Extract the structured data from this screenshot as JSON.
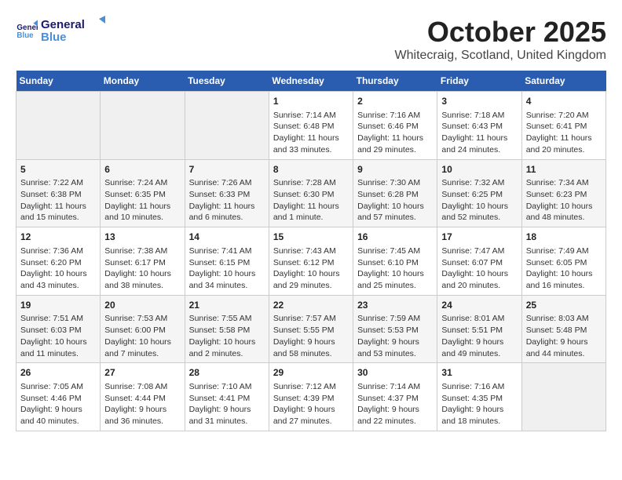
{
  "header": {
    "logo": {
      "line1": "General",
      "line2": "Blue"
    },
    "title": "October 2025",
    "location": "Whitecraig, Scotland, United Kingdom"
  },
  "weekdays": [
    "Sunday",
    "Monday",
    "Tuesday",
    "Wednesday",
    "Thursday",
    "Friday",
    "Saturday"
  ],
  "weeks": [
    [
      {
        "day": "",
        "info": ""
      },
      {
        "day": "",
        "info": ""
      },
      {
        "day": "",
        "info": ""
      },
      {
        "day": "1",
        "info": "Sunrise: 7:14 AM\nSunset: 6:48 PM\nDaylight: 11 hours\nand 33 minutes."
      },
      {
        "day": "2",
        "info": "Sunrise: 7:16 AM\nSunset: 6:46 PM\nDaylight: 11 hours\nand 29 minutes."
      },
      {
        "day": "3",
        "info": "Sunrise: 7:18 AM\nSunset: 6:43 PM\nDaylight: 11 hours\nand 24 minutes."
      },
      {
        "day": "4",
        "info": "Sunrise: 7:20 AM\nSunset: 6:41 PM\nDaylight: 11 hours\nand 20 minutes."
      }
    ],
    [
      {
        "day": "5",
        "info": "Sunrise: 7:22 AM\nSunset: 6:38 PM\nDaylight: 11 hours\nand 15 minutes."
      },
      {
        "day": "6",
        "info": "Sunrise: 7:24 AM\nSunset: 6:35 PM\nDaylight: 11 hours\nand 10 minutes."
      },
      {
        "day": "7",
        "info": "Sunrise: 7:26 AM\nSunset: 6:33 PM\nDaylight: 11 hours\nand 6 minutes."
      },
      {
        "day": "8",
        "info": "Sunrise: 7:28 AM\nSunset: 6:30 PM\nDaylight: 11 hours\nand 1 minute."
      },
      {
        "day": "9",
        "info": "Sunrise: 7:30 AM\nSunset: 6:28 PM\nDaylight: 10 hours\nand 57 minutes."
      },
      {
        "day": "10",
        "info": "Sunrise: 7:32 AM\nSunset: 6:25 PM\nDaylight: 10 hours\nand 52 minutes."
      },
      {
        "day": "11",
        "info": "Sunrise: 7:34 AM\nSunset: 6:23 PM\nDaylight: 10 hours\nand 48 minutes."
      }
    ],
    [
      {
        "day": "12",
        "info": "Sunrise: 7:36 AM\nSunset: 6:20 PM\nDaylight: 10 hours\nand 43 minutes."
      },
      {
        "day": "13",
        "info": "Sunrise: 7:38 AM\nSunset: 6:17 PM\nDaylight: 10 hours\nand 38 minutes."
      },
      {
        "day": "14",
        "info": "Sunrise: 7:41 AM\nSunset: 6:15 PM\nDaylight: 10 hours\nand 34 minutes."
      },
      {
        "day": "15",
        "info": "Sunrise: 7:43 AM\nSunset: 6:12 PM\nDaylight: 10 hours\nand 29 minutes."
      },
      {
        "day": "16",
        "info": "Sunrise: 7:45 AM\nSunset: 6:10 PM\nDaylight: 10 hours\nand 25 minutes."
      },
      {
        "day": "17",
        "info": "Sunrise: 7:47 AM\nSunset: 6:07 PM\nDaylight: 10 hours\nand 20 minutes."
      },
      {
        "day": "18",
        "info": "Sunrise: 7:49 AM\nSunset: 6:05 PM\nDaylight: 10 hours\nand 16 minutes."
      }
    ],
    [
      {
        "day": "19",
        "info": "Sunrise: 7:51 AM\nSunset: 6:03 PM\nDaylight: 10 hours\nand 11 minutes."
      },
      {
        "day": "20",
        "info": "Sunrise: 7:53 AM\nSunset: 6:00 PM\nDaylight: 10 hours\nand 7 minutes."
      },
      {
        "day": "21",
        "info": "Sunrise: 7:55 AM\nSunset: 5:58 PM\nDaylight: 10 hours\nand 2 minutes."
      },
      {
        "day": "22",
        "info": "Sunrise: 7:57 AM\nSunset: 5:55 PM\nDaylight: 9 hours\nand 58 minutes."
      },
      {
        "day": "23",
        "info": "Sunrise: 7:59 AM\nSunset: 5:53 PM\nDaylight: 9 hours\nand 53 minutes."
      },
      {
        "day": "24",
        "info": "Sunrise: 8:01 AM\nSunset: 5:51 PM\nDaylight: 9 hours\nand 49 minutes."
      },
      {
        "day": "25",
        "info": "Sunrise: 8:03 AM\nSunset: 5:48 PM\nDaylight: 9 hours\nand 44 minutes."
      }
    ],
    [
      {
        "day": "26",
        "info": "Sunrise: 7:05 AM\nSunset: 4:46 PM\nDaylight: 9 hours\nand 40 minutes."
      },
      {
        "day": "27",
        "info": "Sunrise: 7:08 AM\nSunset: 4:44 PM\nDaylight: 9 hours\nand 36 minutes."
      },
      {
        "day": "28",
        "info": "Sunrise: 7:10 AM\nSunset: 4:41 PM\nDaylight: 9 hours\nand 31 minutes."
      },
      {
        "day": "29",
        "info": "Sunrise: 7:12 AM\nSunset: 4:39 PM\nDaylight: 9 hours\nand 27 minutes."
      },
      {
        "day": "30",
        "info": "Sunrise: 7:14 AM\nSunset: 4:37 PM\nDaylight: 9 hours\nand 22 minutes."
      },
      {
        "day": "31",
        "info": "Sunrise: 7:16 AM\nSunset: 4:35 PM\nDaylight: 9 hours\nand 18 minutes."
      },
      {
        "day": "",
        "info": ""
      }
    ]
  ]
}
